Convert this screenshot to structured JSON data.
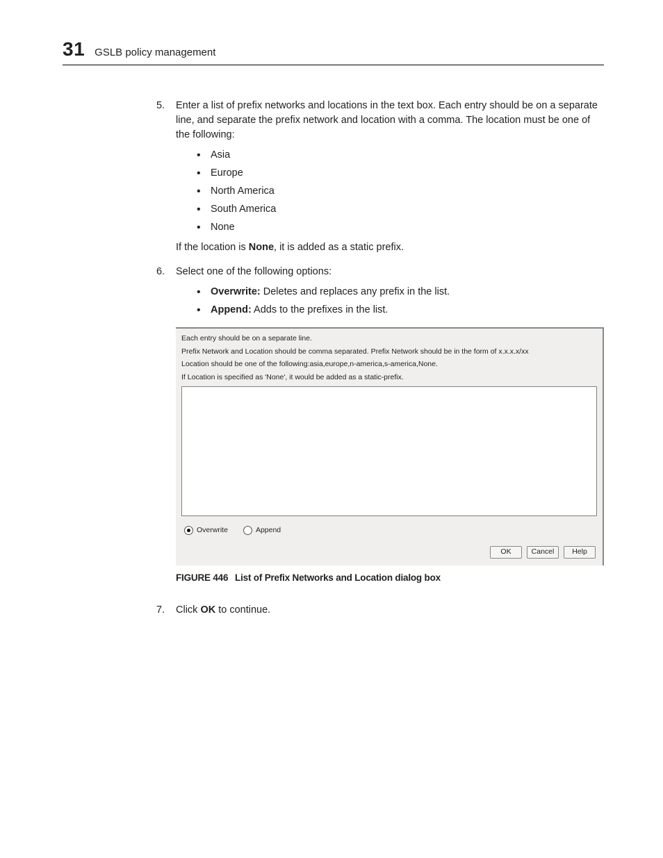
{
  "header": {
    "chapter_number": "31",
    "chapter_title": "GSLB policy management"
  },
  "step5": {
    "num": "5.",
    "text": "Enter a list of prefix networks and locations in the text box. Each entry should be on a separate line, and separate the prefix network and location with a comma. The location must be one of the following:",
    "bullets": [
      "Asia",
      "Europe",
      "North America",
      "South America",
      "None"
    ],
    "tail_pre": "If the location is ",
    "tail_bold": "None",
    "tail_post": ", it is added as a static prefix."
  },
  "step6": {
    "num": "6.",
    "text": "Select one of the following options:",
    "opts": [
      {
        "label": "Overwrite:",
        "desc": " Deletes and replaces any prefix in the list."
      },
      {
        "label": "Append:",
        "desc": " Adds to the prefixes in the list."
      }
    ]
  },
  "dialog": {
    "instr": [
      "Each entry should be on a separate line.",
      "Prefix Network and Location should be comma separated. Prefix Network should be in the form of x.x.x.x/xx",
      "Location should be one of the following:asia,europe,n-america,s-america,None.",
      "If Location is specified as 'None', it would be added as a static-prefix."
    ],
    "textarea_value": "",
    "radio_overwrite": "Overwrite",
    "radio_append": "Append",
    "buttons": {
      "ok": "OK",
      "cancel": "Cancel",
      "help": "Help"
    }
  },
  "figure": {
    "label": "FIGURE 446",
    "title": "List of Prefix Networks and Location dialog box"
  },
  "step7": {
    "num": "7.",
    "pre": "Click ",
    "bold": "OK",
    "post": " to continue."
  }
}
